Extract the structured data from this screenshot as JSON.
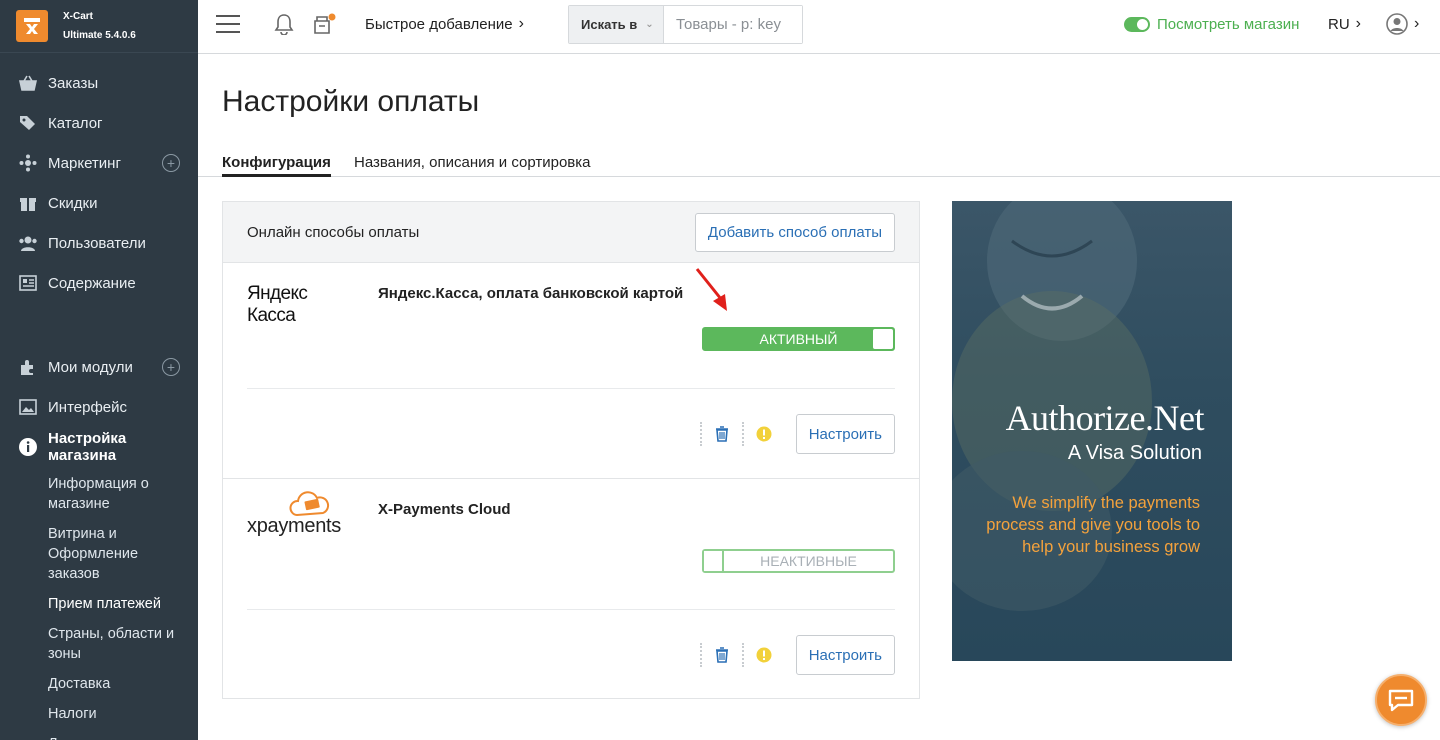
{
  "brand": {
    "name": "X-Cart",
    "version": "Ultimate 5.4.0.6"
  },
  "sidebar": {
    "items": [
      {
        "label": "Заказы"
      },
      {
        "label": "Каталог"
      },
      {
        "label": "Маркетинг"
      },
      {
        "label": "Скидки"
      },
      {
        "label": "Пользователи"
      },
      {
        "label": "Содержание"
      },
      {
        "label": "Мои модули"
      },
      {
        "label": "Интерфейс"
      },
      {
        "label": "Настройка магазина"
      }
    ],
    "subitems": [
      {
        "label": "Информация о магазине"
      },
      {
        "label": "Витрина и Оформление заказов"
      },
      {
        "label": "Прием платежей"
      },
      {
        "label": "Страны, области и зоны"
      },
      {
        "label": "Доставка"
      },
      {
        "label": "Налоги"
      },
      {
        "label": "Локализация"
      }
    ]
  },
  "header": {
    "quick_add": "Быстрое добавление",
    "search_scope": "Искать в",
    "search_placeholder": "Товары - p: key",
    "view_store": "Посмотреть магазин",
    "lang": "RU"
  },
  "page": {
    "title": "Настройки оплаты",
    "tabs": [
      {
        "label": "Конфигурация"
      },
      {
        "label": "Названия, описания и сортировка"
      }
    ]
  },
  "panel": {
    "title": "Онлайн способы оплаты",
    "add_button": "Добавить способ оплаты",
    "methods": [
      {
        "logo_text": "Яндекс Касса",
        "name": "Яндекс.Касса, оплата банковской картой",
        "status": "АКТИВНЫЙ",
        "configure": "Настроить"
      },
      {
        "logo_text": "xpayments",
        "name": "X-Payments Cloud",
        "status": "НЕАКТИВНЫЕ",
        "configure": "Настроить"
      }
    ]
  },
  "banner": {
    "brand": "Authorize.Net",
    "subtitle": "A Visa Solution",
    "copy": "We simplify the payments process and give you tools to help your business grow"
  },
  "colors": {
    "sidebar": "#2e3a44",
    "accent_green": "#5cb85c",
    "link_blue": "#2a6fb5",
    "brand_orange": "#ef8a2e"
  }
}
